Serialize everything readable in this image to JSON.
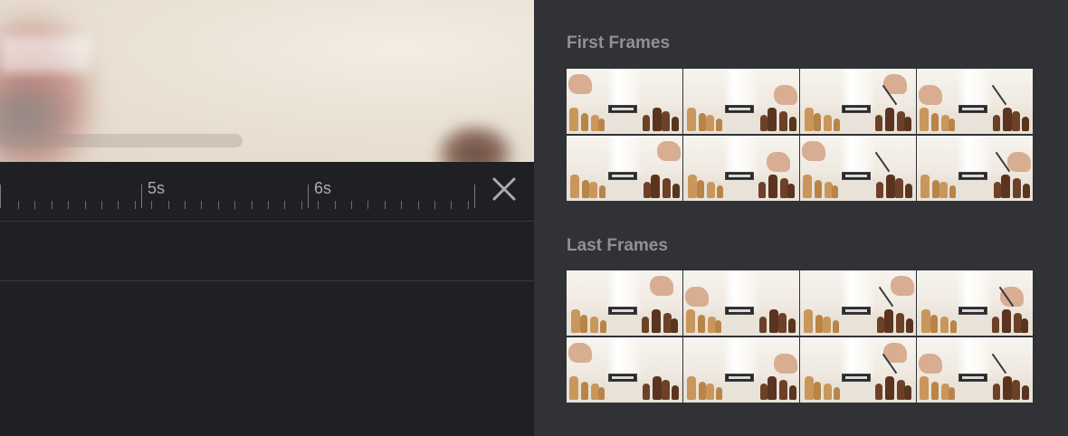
{
  "timeline": {
    "ticks": [
      {
        "label": "5s"
      },
      {
        "label": "6s"
      }
    ]
  },
  "close": {
    "icon": "close-icon",
    "color": "#a9abb0"
  },
  "panel": {
    "first_frames_title": "First Frames",
    "last_frames_title": "Last Frames"
  },
  "colors": {
    "panel_bg": "#313235",
    "editor_bg": "#1f2023",
    "title_text": "#8f9196"
  }
}
